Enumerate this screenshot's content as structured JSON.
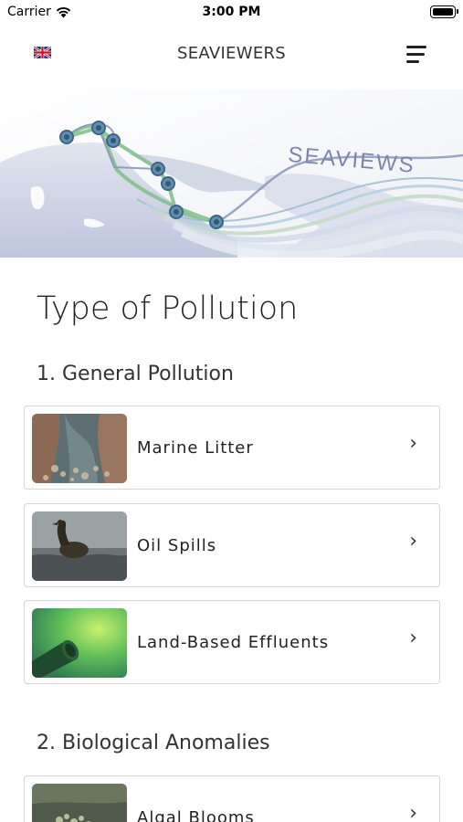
{
  "status_bar": {
    "carrier": "Carrier",
    "time": "3:00 PM"
  },
  "header": {
    "title": "SEAVIEWERS",
    "language_icon": "uk-flag-icon",
    "menu_icon": "hamburger-menu-icon"
  },
  "hero": {
    "brand_text": "SEAVIEWS"
  },
  "page": {
    "title": "Type of Pollution"
  },
  "sections": [
    {
      "title": "1. General Pollution",
      "items": [
        {
          "label": "Marine Litter",
          "chevron": "›"
        },
        {
          "label": "Oil Spills",
          "chevron": "›"
        },
        {
          "label": "Land-Based Effluents",
          "chevron": "›"
        }
      ]
    },
    {
      "title": "2. Biological Anomalies",
      "items": [
        {
          "label": "Algal Blooms",
          "chevron": "›"
        }
      ]
    }
  ]
}
